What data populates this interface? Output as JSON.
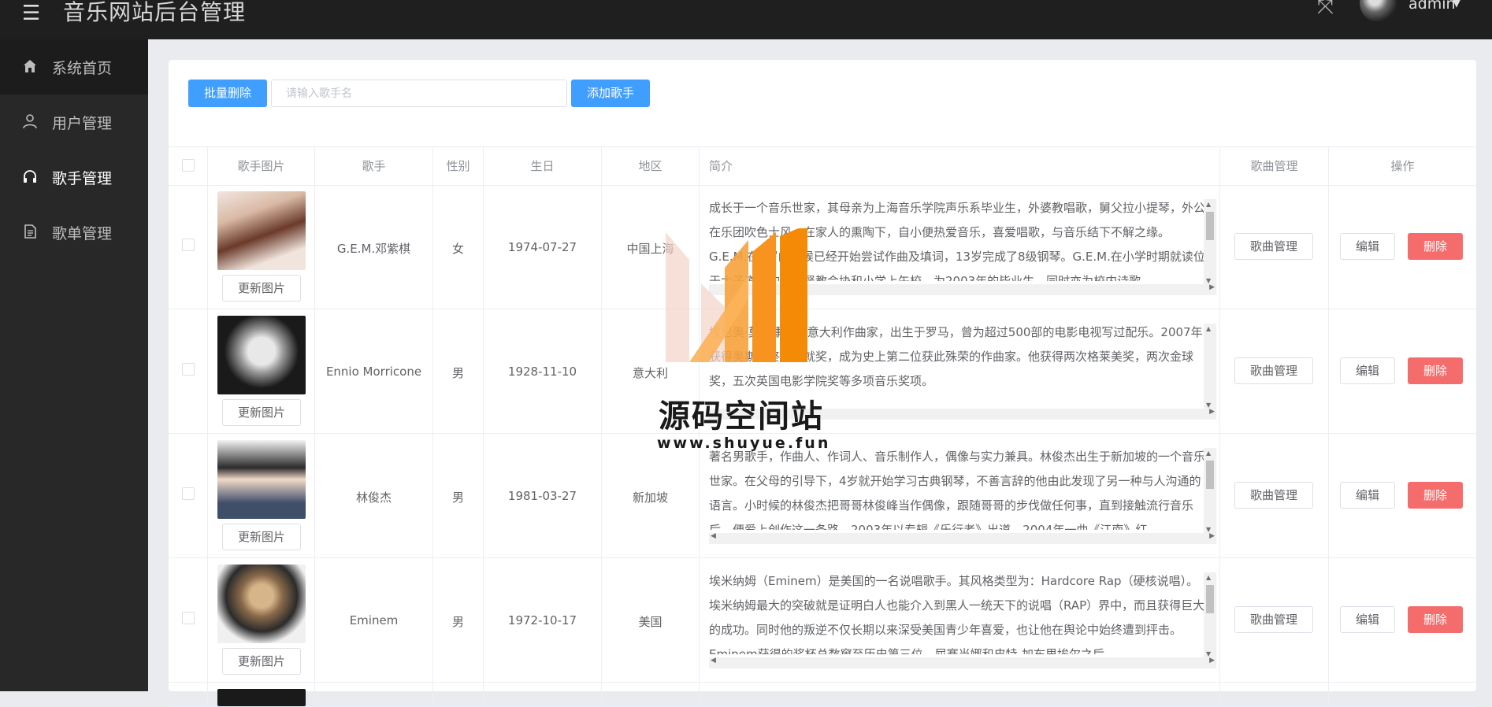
{
  "header": {
    "title": "音乐网站后台管理",
    "user": "admin",
    "menu_icon": "menu-icon",
    "fullscreen_icon": "fullscreen-icon"
  },
  "sidebar": {
    "items": [
      {
        "label": "系统首页",
        "icon": "home-icon"
      },
      {
        "label": "用户管理",
        "icon": "user-icon"
      },
      {
        "label": "歌手管理",
        "icon": "headphones-icon"
      },
      {
        "label": "歌单管理",
        "icon": "document-icon"
      }
    ]
  },
  "toolbar": {
    "batch_delete": "批量删除",
    "search_placeholder": "请输入歌手名",
    "add_singer": "添加歌手"
  },
  "table": {
    "columns": [
      "歌手图片",
      "歌手",
      "性别",
      "生日",
      "地区",
      "简介",
      "歌曲管理",
      "操作"
    ],
    "update_image": "更新图片",
    "songs_button": "歌曲管理",
    "edit_button": "编辑",
    "delete_button": "删除",
    "rows": [
      {
        "name": "G.E.M.邓紫棋",
        "gender": "女",
        "birthday": "1974-07-27",
        "region": "中国上海",
        "intro": "成长于一个音乐世家，其母亲为上海音乐学院声乐系毕业生，外婆教唱歌，舅父拉小提琴，外公在乐团吹色士风。在家人的熏陶下，自小便热爱音乐，喜爱唱歌，与音乐结下不解之缘。G.E.M.在5岁的时候已经开始尝试作曲及填词，13岁完成了8级钢琴。G.E.M.在小学时期就读位于太子道西的华基督教会协和小学上午校，为2003年的毕业生，同时亦为校内诗歌"
      },
      {
        "name": "Ennio Morricone",
        "gender": "男",
        "birthday": "1928-11-10",
        "region": "意大利",
        "intro": "埃尼奥·莫里康内，意大利作曲家，出生于罗马，曾为超过500部的电影电视写过配乐。2007年获得奥斯卡终身成就奖，成为史上第二位获此殊荣的作曲家。他获得两次格莱美奖，两次金球奖，五次英国电影学院奖等多项音乐奖项。"
      },
      {
        "name": "林俊杰",
        "gender": "男",
        "birthday": "1981-03-27",
        "region": "新加坡",
        "intro": "著名男歌手，作曲人、作词人、音乐制作人，偶像与实力兼具。林俊杰出生于新加坡的一个音乐世家。在父母的引导下，4岁就开始学习古典钢琴，不善言辞的他由此发现了另一种与人沟通的语言。小时候的林俊杰把哥哥林俊峰当作偶像，跟随哥哥的步伐做任何事，直到接触流行音乐后，便爱上创作这一条路。2003年以专辑《乐行者》出道，2004年一曲《江南》红"
      },
      {
        "name": "Eminem",
        "gender": "男",
        "birthday": "1972-10-17",
        "region": "美国",
        "intro": "埃米纳姆（Eminem）是美国的一名说唱歌手。其风格类型为：Hardcore Rap（硬核说唱）。埃米纳姆最大的突破就是证明白人也能介入到黑人一统天下的说唱（RAP）界中，而且获得巨大的成功。同时他的叛逆不仅长期以来深受美国青少年喜爱，也让他在舆论中始终遭到抨击。Eminem获得的奖杯总数窜至历史第三位，屈赛当娜和皮特-加布里埃尔之后"
      }
    ]
  },
  "watermark": {
    "title": "源码空间站",
    "url": "www.shuyue.fun"
  }
}
